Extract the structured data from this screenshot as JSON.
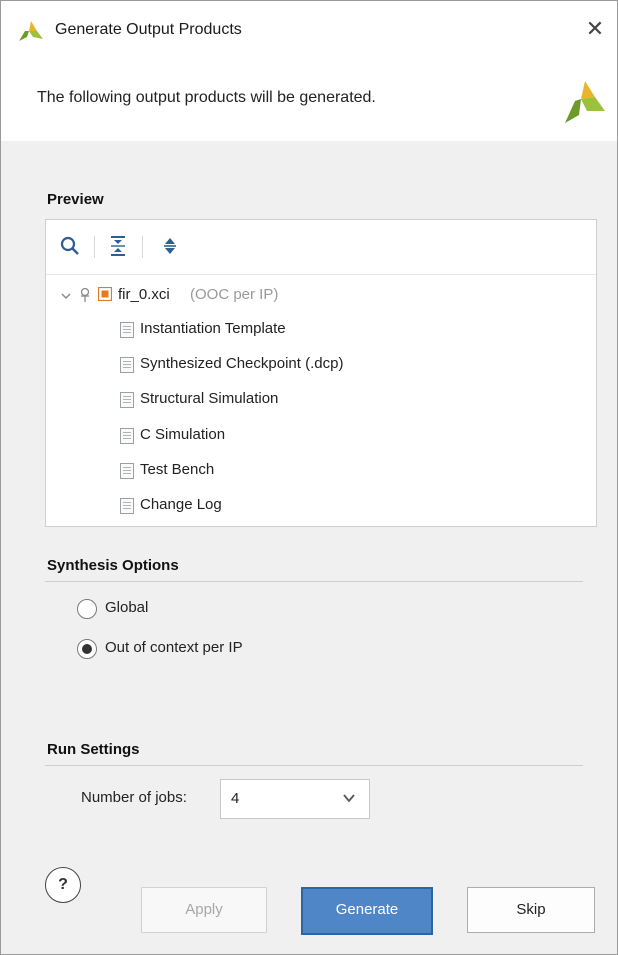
{
  "window": {
    "title": "Generate Output Products",
    "close_glyph": "✕"
  },
  "banner": {
    "message": "The following output products will be generated."
  },
  "preview": {
    "section_title": "Preview",
    "toolbar_icons": [
      "search-icon",
      "collapse-all-icon",
      "expand-all-icon"
    ],
    "root": {
      "name": "fir_0.xci",
      "suffix": "(OOC per IP)"
    },
    "children": [
      "Instantiation Template",
      "Synthesized Checkpoint (.dcp)",
      "Structural Simulation",
      "C Simulation",
      "Test Bench",
      "Change Log"
    ]
  },
  "synthesis": {
    "section_title": "Synthesis Options",
    "options": [
      {
        "label": "Global",
        "selected": false
      },
      {
        "label": "Out of context per IP",
        "selected": true
      }
    ]
  },
  "run": {
    "section_title": "Run Settings",
    "jobs_label": "Number of jobs:",
    "jobs_value": "4"
  },
  "buttons": {
    "help": "?",
    "apply": "Apply",
    "generate": "Generate",
    "skip": "Skip"
  },
  "colors": {
    "primary_button": "#4f86c8",
    "logo_green": "#6e9a2a",
    "logo_yellow": "#e8b52a",
    "ip_icon": "#e07b1f"
  }
}
